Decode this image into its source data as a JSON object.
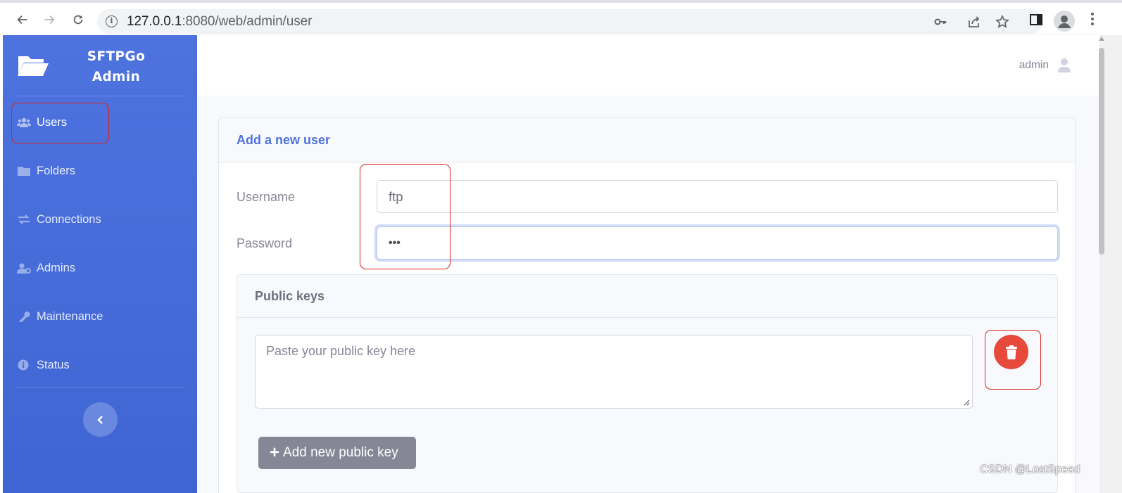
{
  "browser": {
    "url_host": "127.0.0.1",
    "url_rest": ":8080/web/admin/user"
  },
  "sidebar": {
    "brand_line1": "SFTPGo",
    "brand_line2": "Admin",
    "items": [
      {
        "label": "Users",
        "icon": "users-icon"
      },
      {
        "label": "Folders",
        "icon": "folder-icon"
      },
      {
        "label": "Connections",
        "icon": "exchange-icon"
      },
      {
        "label": "Admins",
        "icon": "user-cog-icon"
      },
      {
        "label": "Maintenance",
        "icon": "wrench-icon"
      },
      {
        "label": "Status",
        "icon": "info-circle-icon"
      }
    ]
  },
  "topbar": {
    "user_name": "admin"
  },
  "form": {
    "title": "Add a new user",
    "username_label": "Username",
    "username_value": "ftp",
    "password_label": "Password",
    "password_value": "•••",
    "public_keys": {
      "title": "Public keys",
      "placeholder": "Paste your public key here",
      "add_button_label": "Add new public key"
    }
  },
  "watermark": "CSDN @LostSpeed",
  "colors": {
    "primary": "#4e73df",
    "danger": "#e74a3b",
    "secondary": "#858796",
    "annotation": "#d9231e"
  }
}
